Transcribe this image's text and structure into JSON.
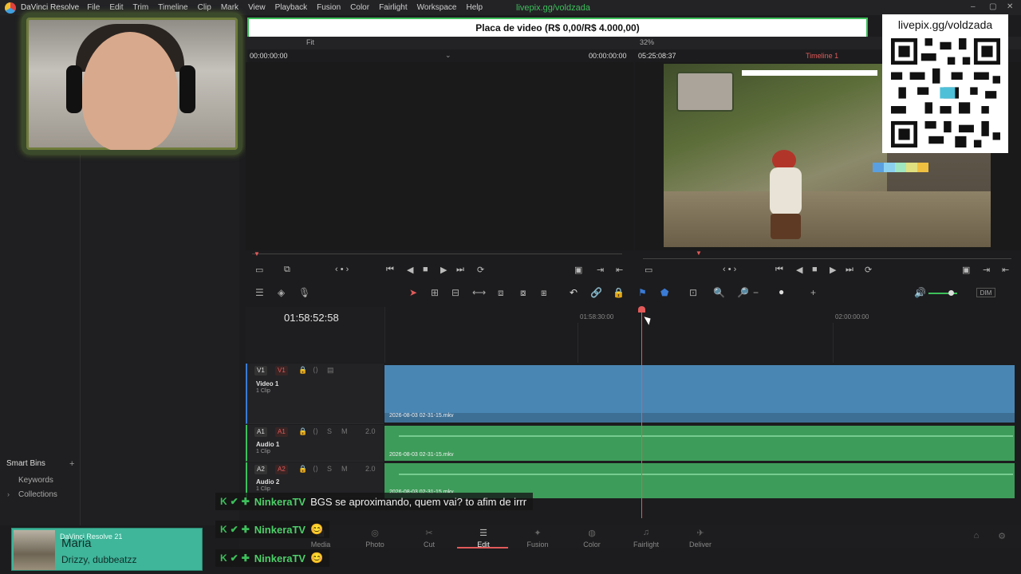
{
  "app": {
    "name": "DaVinci Resolve",
    "menus": [
      "File",
      "Edit",
      "Trim",
      "Timeline",
      "Clip",
      "Mark",
      "View",
      "Playback",
      "Fusion",
      "Color",
      "Fairlight",
      "Workspace",
      "Help"
    ]
  },
  "overlay": {
    "livepix_top": "livepix.gg/voldzada",
    "goal_text": "Placa de video (R$ 0,00/R$ 4.000,00)",
    "goal_progress": 0.0,
    "qr_label": "livepix.gg/voldzada"
  },
  "viewer": {
    "fit_label": "Fit",
    "zoom_label": "32%",
    "source_tc_left": "00:00:00:00",
    "source_tc_right": "00:00:00:00",
    "timeline_duration": "05:25:08:37",
    "timeline_name": "Timeline 1"
  },
  "timeline": {
    "timecode": "01:58:52:58",
    "ruler_labels": [
      "01:58:30:00",
      "02:00:00:00"
    ],
    "tracks": [
      {
        "id": "V1",
        "tag": "V1",
        "name": "Video 1",
        "clips": "1 Clip",
        "clip_file": "2026-08-03 02-31-15.mkv"
      },
      {
        "id": "A1",
        "tag": "A1",
        "name": "Audio 1",
        "clips": "1 Clip",
        "clip_file": "2026-08-03 02-31-15.mkv",
        "channels": "2.0"
      },
      {
        "id": "A2",
        "tag": "A2",
        "name": "Audio 2",
        "clips": "1 Clip",
        "clip_file": "2026-08-03 02-31-15.mkv",
        "channels": "2.0"
      }
    ]
  },
  "media_pool": {
    "smart_bins": "Smart Bins",
    "keywords": "Keywords",
    "collections": "Collections"
  },
  "toolbar": {
    "dim_label": "DIM"
  },
  "pages": [
    "Media",
    "Photo",
    "Cut",
    "Edit",
    "Fusion",
    "Color",
    "Fairlight",
    "Deliver"
  ],
  "active_page": "Edit",
  "chat": [
    {
      "user": "NinkeraTV",
      "message": "BGS se aproximando, quem vai? to afim de irrr"
    },
    {
      "user": "NinkeraTV",
      "message": "😊"
    },
    {
      "user": "NinkeraTV",
      "message": "😊"
    }
  ],
  "now_playing": {
    "app": "DaVinci Resolve 21",
    "title": "Maria",
    "artist": "Drizzy, dubbeatzz"
  }
}
